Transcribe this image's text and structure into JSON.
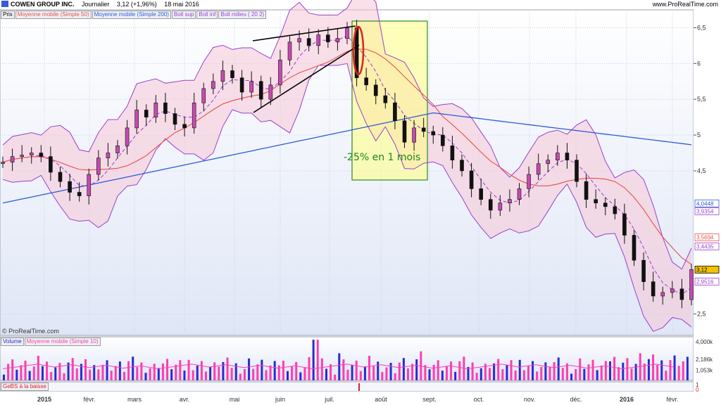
{
  "header": {
    "title": "COWEN GROUP INC.",
    "period": "Journalier",
    "quote": "3,12 (+1,96%)",
    "date": "18 mai 2016",
    "site": "www.ProRealTime.com"
  },
  "legend_price": [
    "Prix",
    "Moyenne mobile (Simple 50)",
    "Moyenne mobile (Simple 200)",
    "Boll sup",
    "Boll inf",
    "Boll milieu ( 20 2)"
  ],
  "legend_volume": [
    "Volume",
    "Moyenne mobile (Simple 10)"
  ],
  "legend_signal": [
    "GeBS à la baisse"
  ],
  "watermark": "© ProRealTime.com",
  "annotation": "-25% en 1 mois",
  "colors": {
    "sma50": "#e8504a",
    "sma200": "#2d5bd6",
    "bollinger_band": "#9b3fd0",
    "bollinger_fill": "#f5c6d6",
    "candle_up": "#c44bb0",
    "candle_body": "#e0308f",
    "volume_pink": "#ff3db0",
    "volume_blue": "#2a2ad0",
    "highlight_box": "#ffff80",
    "annotation_text": "#1a8a1a",
    "ellipse": "#e02020",
    "signal": "#e02020"
  },
  "chart_data": {
    "type": "candlestick",
    "title": "COWEN GROUP INC.",
    "ylim": [
      2.2,
      6.75
    ],
    "y_ticks": [
      "6,5",
      "6",
      "5,5",
      "5",
      "4,5",
      "2,5"
    ],
    "x_ticks": [
      "2015",
      "févr.",
      "mars",
      "avr.",
      "mai",
      "juin",
      "juil.",
      "août",
      "sept.",
      "oct.",
      "nov.",
      "déc.",
      "2016",
      "févr."
    ],
    "price_close_weekly": [
      4.62,
      4.7,
      4.72,
      4.75,
      4.7,
      4.48,
      4.35,
      4.2,
      4.15,
      4.45,
      4.68,
      4.75,
      4.85,
      5.1,
      5.35,
      5.25,
      5.45,
      5.3,
      5.15,
      5.1,
      5.45,
      5.65,
      5.75,
      5.9,
      5.8,
      5.6,
      5.75,
      5.5,
      5.7,
      6.05,
      6.3,
      6.35,
      6.25,
      6.4,
      6.3,
      6.35,
      6.5,
      5.8,
      5.7,
      5.55,
      5.45,
      5.2,
      4.9,
      5.1,
      5.05,
      5.0,
      4.85,
      4.65,
      4.5,
      4.25,
      4.1,
      3.95,
      4.05,
      4.1,
      4.25,
      4.45,
      4.6,
      4.65,
      4.75,
      4.65,
      4.35,
      4.1,
      4.05,
      4.0,
      3.9,
      3.6,
      3.25,
      2.95,
      2.75,
      2.8,
      2.85,
      2.7,
      3.12
    ],
    "levels": [
      {
        "label": "4,0448",
        "color": "#2d5bd6",
        "value": 4.0448
      },
      {
        "label": "3,9354",
        "color": "#9b3fd0",
        "value": 3.9354
      },
      {
        "label": "3,5694",
        "color": "#e8504a",
        "value": 3.5694
      },
      {
        "label": "3,4435",
        "color": "#9b3fd0",
        "value": 3.4435
      },
      {
        "label": "3,12",
        "color": "#000000",
        "value": 3.12
      },
      {
        "label": "2,9516",
        "color": "#9b3fd0",
        "value": 2.9516
      }
    ],
    "volume_ticks": [
      "4,000k",
      "2,186k",
      "1,053k"
    ],
    "signal_ticks": [
      "1",
      "0"
    ]
  }
}
